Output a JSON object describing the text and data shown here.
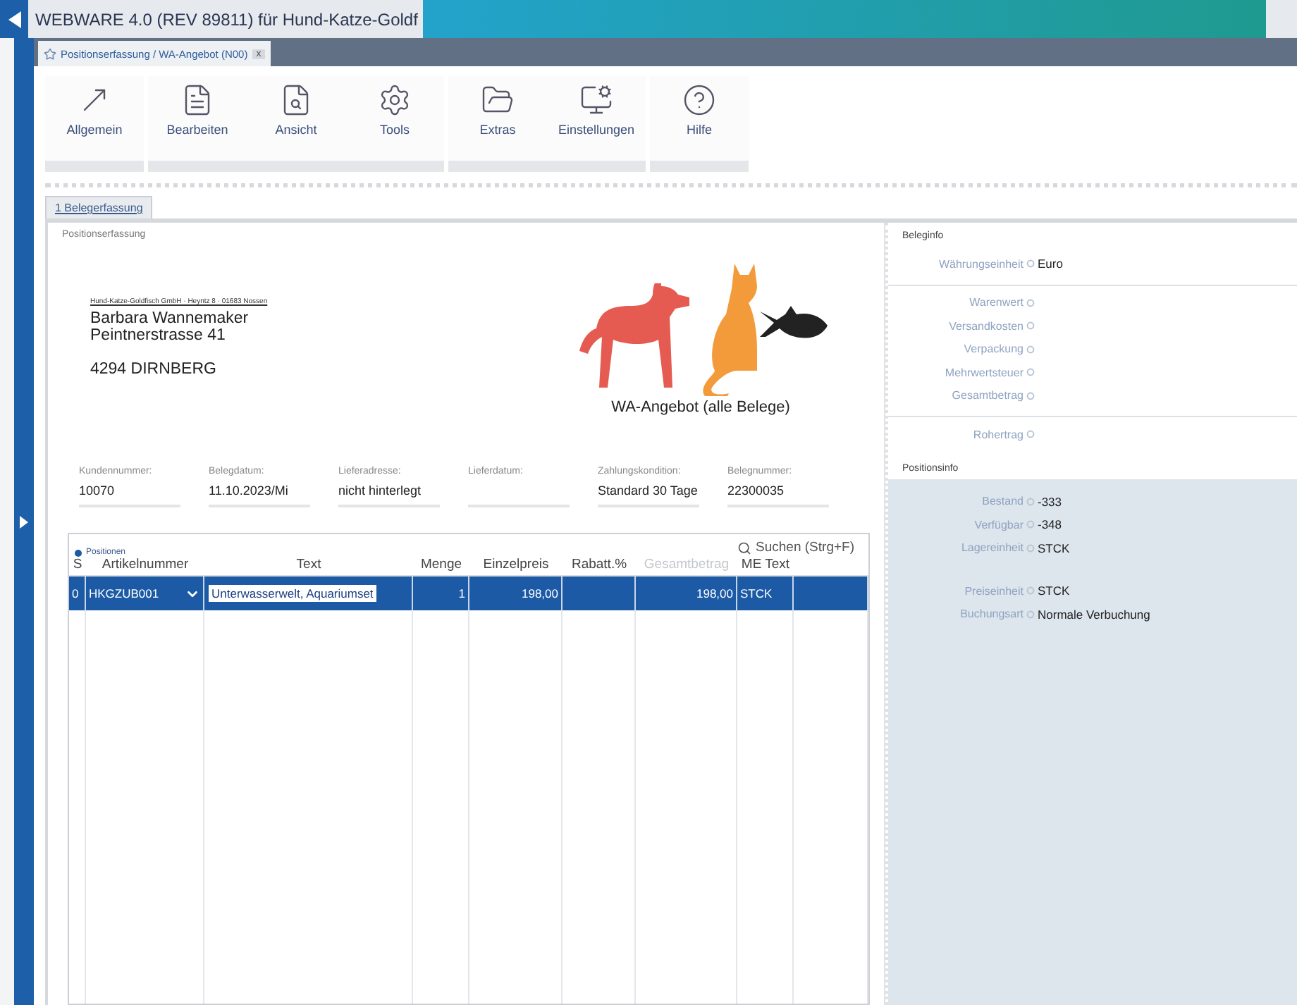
{
  "window": {
    "title": "WEBWARE 4.0 (REV 89811) für Hund-Katze-Goldf"
  },
  "doc_tab": {
    "label": "Positionserfassung / WA-Angebot (N00)",
    "close": "x"
  },
  "toolbar": {
    "groups": [
      {
        "items": [
          {
            "label": "Allgemein",
            "kind": "arrow"
          }
        ]
      },
      {
        "items": [
          {
            "label": "Bearbeiten",
            "kind": "edit"
          },
          {
            "label": "Ansicht",
            "kind": "view"
          },
          {
            "label": "Tools",
            "kind": "tools"
          }
        ]
      },
      {
        "items": [
          {
            "label": "Extras",
            "kind": "extras"
          },
          {
            "label": "Einstellungen",
            "kind": "settings"
          }
        ]
      },
      {
        "items": [
          {
            "label": "Hilfe",
            "kind": "help"
          }
        ]
      }
    ]
  },
  "form_tabs": [
    {
      "label": "1 Belegerfassung",
      "selected": true
    }
  ],
  "document": {
    "section": "Positionserfassung",
    "sender": "Hund-Katze-Goldfisch GmbH · Heyntz 8 · 01683 Nossen",
    "address": [
      "Barbara Wannemaker",
      "Peintnerstrasse 41",
      "4294 DIRNBERG"
    ],
    "doc_title": "WA-Angebot (alle Belege)",
    "fields": [
      {
        "label": "Kundennummer:",
        "value": "10070"
      },
      {
        "label": "Belegdatum:",
        "value": "11.10.2023/Mi"
      },
      {
        "label": "Lieferadresse:",
        "value": "nicht hinterlegt"
      },
      {
        "label": "Lieferdatum:"
      },
      {
        "label": "Zahlungskondition:",
        "value": "Standard 30 Tage"
      },
      {
        "label": "Belegnummer:",
        "value": "22300035"
      }
    ]
  },
  "positions": {
    "title": "Positionen",
    "search": "Suchen (Strg+F)",
    "columns": [
      {
        "label": "S",
        "disabled": false
      },
      {
        "label": "Artikelnummer",
        "disabled": false
      },
      {
        "label": "Text",
        "disabled": false
      },
      {
        "label": "Menge",
        "disabled": false
      },
      {
        "label": "Einzelpreis",
        "disabled": false
      },
      {
        "label": "Rabatt.%",
        "disabled": false
      },
      {
        "label": "Gesamtbetrag",
        "disabled": true
      },
      {
        "label": "ME Text",
        "disabled": false
      }
    ],
    "rows": [
      {
        "selected": true,
        "cells": [
          "0",
          "HKGZUB001",
          "Unterwasserwelt, Aquariumset",
          "1",
          "198,00",
          null,
          "198,00",
          "STCK"
        ]
      }
    ]
  },
  "beleginfo": {
    "title": "Beleginfo",
    "groups": [
      [
        {
          "label": "Währungseinheit",
          "value": "Euro"
        }
      ],
      [
        {
          "label": "Warenwert"
        },
        {
          "label": "Versandkosten"
        },
        {
          "label": "Verpackung"
        },
        {
          "label": "Mehrwertsteuer"
        },
        {
          "label": "Gesamtbetrag"
        }
      ],
      [
        {
          "label": "Rohertrag"
        }
      ]
    ]
  },
  "positionsinfo": {
    "title": "Positionsinfo",
    "groups": [
      [
        {
          "label": "Bestand",
          "value": "-333"
        },
        {
          "label": "Verfügbar",
          "value": "-348"
        },
        {
          "label": "Lagereinheit",
          "value": "STCK"
        }
      ],
      [
        {
          "label": "Preiseinheit",
          "value": "STCK"
        },
        {
          "label": "Buchungsart",
          "value": "Normale Verbuchung"
        }
      ]
    ]
  }
}
